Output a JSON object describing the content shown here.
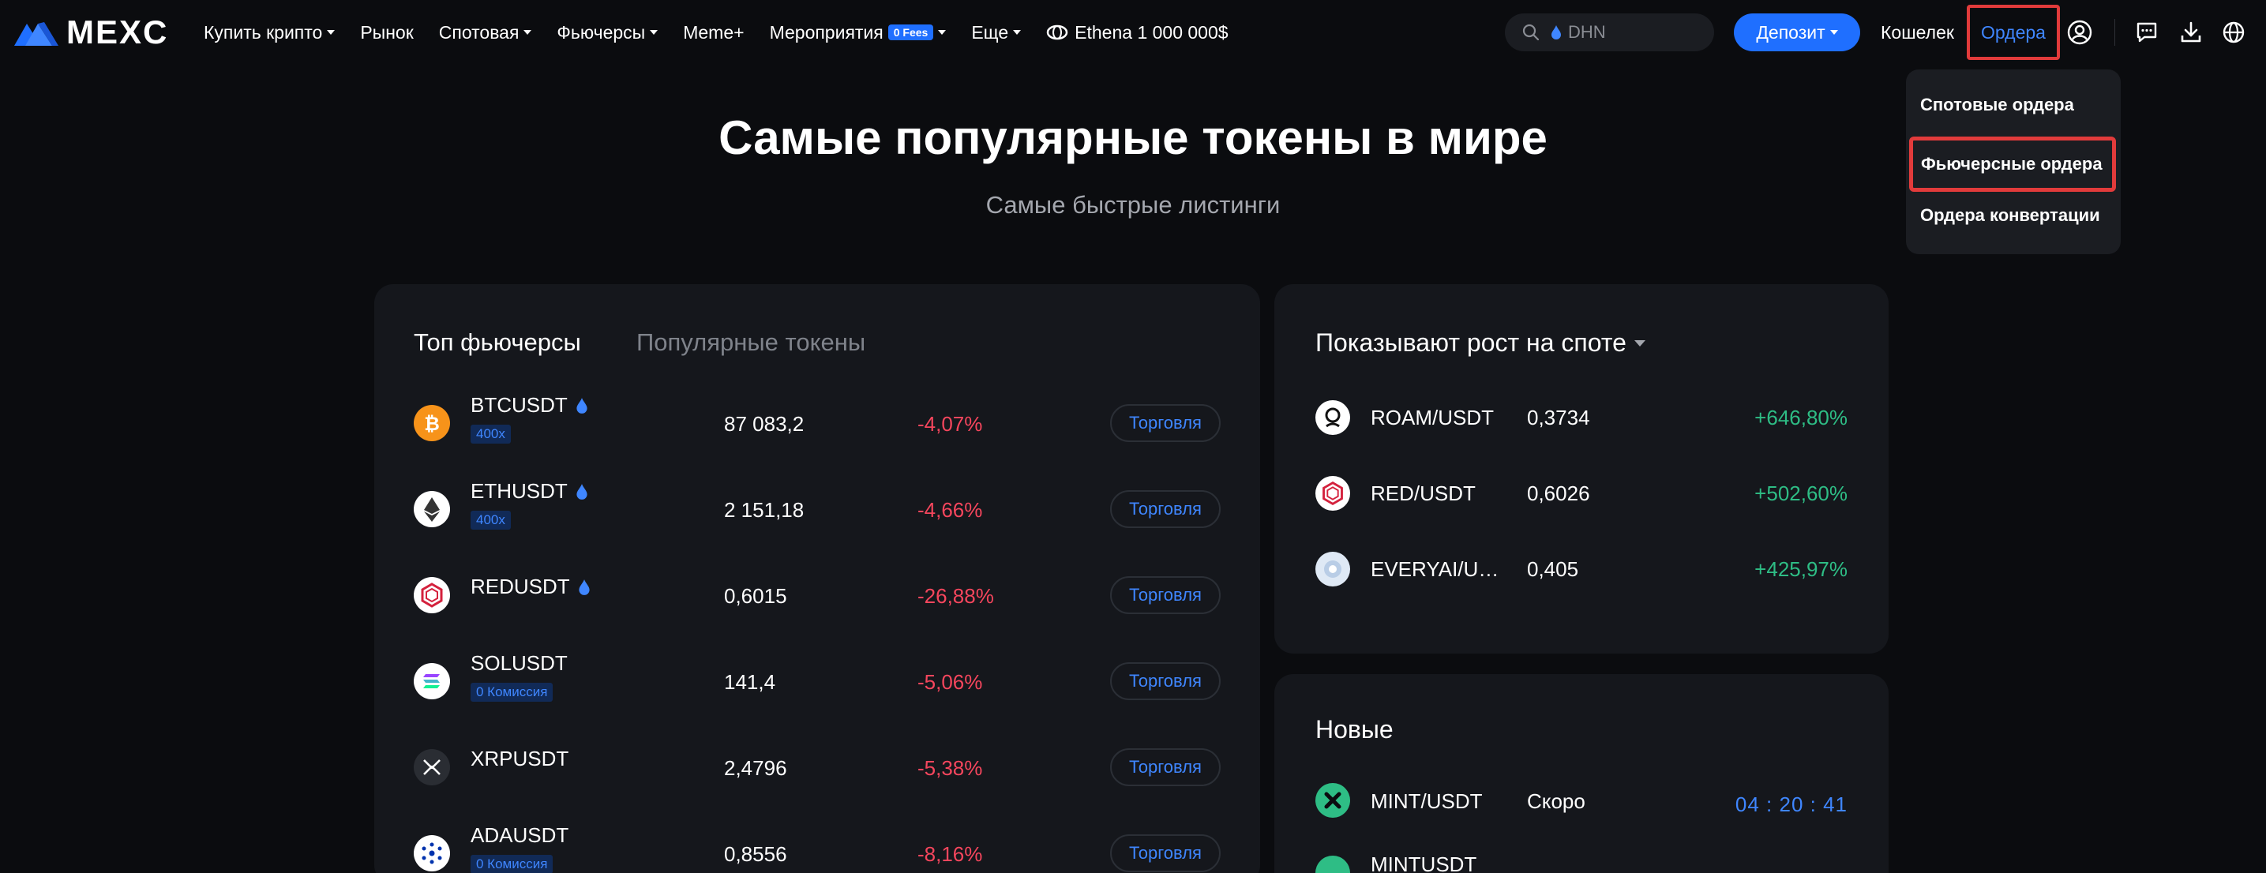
{
  "header": {
    "logo_text": "MEXC",
    "nav": [
      {
        "label": "Купить крипто",
        "dropdown": true
      },
      {
        "label": "Рынок",
        "dropdown": false
      },
      {
        "label": "Спотовая",
        "dropdown": true
      },
      {
        "label": "Фьючерсы",
        "dropdown": true
      },
      {
        "label": "Meme+",
        "dropdown": false
      },
      {
        "label": "Мероприятия",
        "dropdown": true,
        "badge": "0 Fees"
      },
      {
        "label": "Еще",
        "dropdown": true
      },
      {
        "label": "Ethena 1 000 000$",
        "dropdown": false
      }
    ],
    "search_placeholder": "DHN",
    "deposit_label": "Депозит",
    "wallet_label": "Кошелек",
    "orders_label": "Ордера",
    "icons": [
      "user-icon",
      "chat-icon",
      "download-icon",
      "globe-icon"
    ]
  },
  "orders_menu": {
    "items": [
      "Спотовые ордера",
      "Фьючерсные ордера",
      "Ордера конвертации"
    ],
    "highlighted_index": 1
  },
  "hero": {
    "title": "Самые популярные токены в мире",
    "subtitle": "Самые быстрые листинги"
  },
  "futures_card": {
    "tabs": [
      "Топ фьючерсы",
      "Популярные токены"
    ],
    "active_tab": 0,
    "trade_label": "Торговля",
    "rows": [
      {
        "pair": "BTCUSDT",
        "fire": true,
        "tag": "400x",
        "price": "87 083,2",
        "change": "-4,07%",
        "icon": "bitcoin-icon"
      },
      {
        "pair": "ETHUSDT",
        "fire": true,
        "tag": "400x",
        "price": "2 151,18",
        "change": "-4,66%",
        "icon": "ethereum-icon"
      },
      {
        "pair": "REDUSDT",
        "fire": true,
        "tag": "",
        "price": "0,6015",
        "change": "-26,88%",
        "icon": "red-token-icon"
      },
      {
        "pair": "SOLUSDT",
        "fire": false,
        "tag": "0 Комиссия",
        "price": "141,4",
        "change": "-5,06%",
        "icon": "solana-icon"
      },
      {
        "pair": "XRPUSDT",
        "fire": false,
        "tag": "",
        "price": "2,4796",
        "change": "-5,38%",
        "icon": "xrp-icon"
      },
      {
        "pair": "ADAUSDT",
        "fire": false,
        "tag": "0 Комиссия",
        "price": "0,8556",
        "change": "-8,16%",
        "icon": "cardano-icon"
      }
    ]
  },
  "spot_gainers": {
    "title": "Показывают рост на споте",
    "rows": [
      {
        "pair": "ROAM/USDT",
        "price": "0,3734",
        "change": "+646,80%",
        "icon": "roam-icon"
      },
      {
        "pair": "RED/USDT",
        "price": "0,6026",
        "change": "+502,60%",
        "icon": "red-token-icon"
      },
      {
        "pair": "EVERYAI/USDT",
        "price": "0,405",
        "change": "+425,97%",
        "icon": "everyai-icon"
      }
    ]
  },
  "new_listings": {
    "title": "Новые",
    "rows": [
      {
        "pair": "MINT/USDT",
        "status": "Скоро",
        "countdown": "04 : 20 : 41",
        "icon": "mint-icon"
      },
      {
        "pair": "MINTUSDT",
        "status": "",
        "countdown": "",
        "icon": "mint-icon"
      }
    ]
  },
  "colors": {
    "background": "#0b0c0f",
    "card": "#15171c",
    "accent_blue": "#1f6fff",
    "link_blue": "#3f86ff",
    "negative": "#f6465d",
    "positive": "#2ebd85",
    "highlight_red": "#e23b3b"
  }
}
